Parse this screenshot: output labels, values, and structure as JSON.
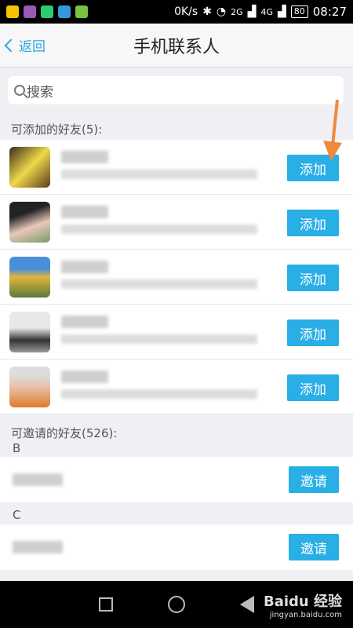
{
  "status_bar": {
    "network_speed": "0K/s",
    "sig1": "2G",
    "sig2": "4G",
    "battery": "80",
    "time": "08:27"
  },
  "header": {
    "back_label": "返回",
    "title": "手机联系人"
  },
  "search": {
    "placeholder": "搜索"
  },
  "addable": {
    "label": "可添加的好友(5):",
    "button_label": "添加"
  },
  "invitable": {
    "label": "可邀请的好友(526):",
    "button_label": "邀请",
    "letters": [
      "B",
      "C"
    ]
  },
  "watermark": {
    "brand": "Baidu 经验",
    "url": "jingyan.baidu.com"
  },
  "colors": {
    "accent": "#29aee6",
    "annotation_arrow": "#f08a3c"
  }
}
